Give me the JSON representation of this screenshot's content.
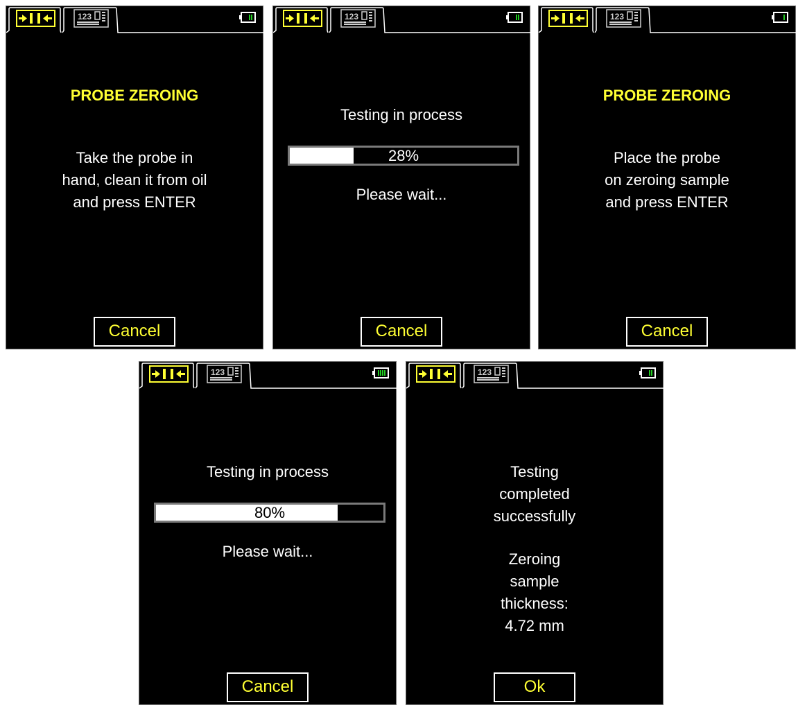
{
  "colors": {
    "accent": "#ffff33",
    "text": "#ffffff",
    "background": "#000000",
    "battery": "#22cc22"
  },
  "tabs": [
    {
      "icon": "probe-zeroing-icon",
      "active": true
    },
    {
      "icon": "numeric-display-icon",
      "active": false
    }
  ],
  "screens": [
    {
      "title": "PROBE ZEROING",
      "lines": [
        "Take the probe in",
        "hand, clean it from oil",
        "and press ENTER"
      ],
      "button": "Cancel"
    },
    {
      "status": "Testing in process",
      "progress": {
        "value": 28,
        "label": "28%"
      },
      "wait": "Please wait...",
      "button": "Cancel"
    },
    {
      "title": "PROBE ZEROING",
      "lines": [
        "Place the probe",
        "on zeroing sample",
        "and press ENTER"
      ],
      "button": "Cancel"
    },
    {
      "status": "Testing in process",
      "progress": {
        "value": 80,
        "label": "80%"
      },
      "wait": "Please wait...",
      "button": "Cancel"
    },
    {
      "lines": [
        "Testing",
        "completed",
        "successfully"
      ],
      "lines2": [
        "Zeroing",
        "sample",
        "thickness:",
        "4.72 mm"
      ],
      "button": "Ok"
    }
  ]
}
